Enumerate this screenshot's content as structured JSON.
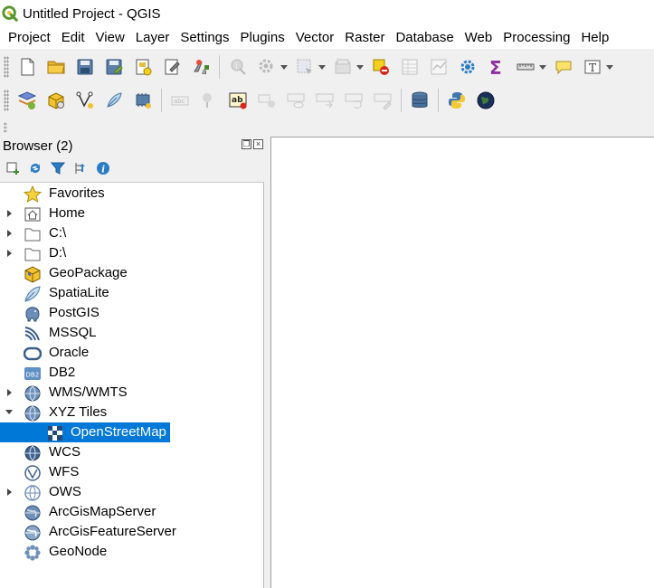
{
  "window": {
    "title": "Untitled Project - QGIS"
  },
  "menubar": [
    "Project",
    "Edit",
    "View",
    "Layer",
    "Settings",
    "Plugins",
    "Vector",
    "Raster",
    "Database",
    "Web",
    "Processing",
    "Help"
  ],
  "browser": {
    "title": "Browser (2)",
    "items": [
      {
        "label": "Favorites",
        "icon": "star-icon",
        "expander": "none"
      },
      {
        "label": "Home",
        "icon": "home-icon",
        "expander": "collapsed"
      },
      {
        "label": "C:\\",
        "icon": "folder-icon",
        "expander": "collapsed"
      },
      {
        "label": "D:\\",
        "icon": "folder-icon",
        "expander": "collapsed"
      },
      {
        "label": "GeoPackage",
        "icon": "geopackage-icon",
        "expander": "none"
      },
      {
        "label": "SpatiaLite",
        "icon": "spatialite-feather-icon",
        "expander": "none"
      },
      {
        "label": "PostGIS",
        "icon": "postgis-elephant-icon",
        "expander": "none"
      },
      {
        "label": "MSSQL",
        "icon": "mssql-icon",
        "expander": "none"
      },
      {
        "label": "Oracle",
        "icon": "oracle-icon",
        "expander": "none"
      },
      {
        "label": "DB2",
        "icon": "db2-icon",
        "expander": "none"
      },
      {
        "label": "WMS/WMTS",
        "icon": "globe-icon",
        "expander": "collapsed"
      },
      {
        "label": "XYZ Tiles",
        "icon": "globe-icon",
        "expander": "expanded"
      },
      {
        "label": "OpenStreetMap",
        "icon": "tiles-icon",
        "expander": "none",
        "child": true,
        "selected": true
      },
      {
        "label": "WCS",
        "icon": "wcs-globe-icon",
        "expander": "none"
      },
      {
        "label": "WFS",
        "icon": "wfs-globe-icon",
        "expander": "none"
      },
      {
        "label": "OWS",
        "icon": "ows-globe-icon",
        "expander": "collapsed"
      },
      {
        "label": "ArcGisMapServer",
        "icon": "arcgis-globe-icon",
        "expander": "none"
      },
      {
        "label": "ArcGisFeatureServer",
        "icon": "arcgis-globe-icon",
        "expander": "none"
      },
      {
        "label": "GeoNode",
        "icon": "geonode-icon",
        "expander": "none"
      }
    ]
  },
  "colors": {
    "selection": "#0078d7",
    "qgis_green": "#589632",
    "toolbar_bg": "#f0f0f0"
  }
}
